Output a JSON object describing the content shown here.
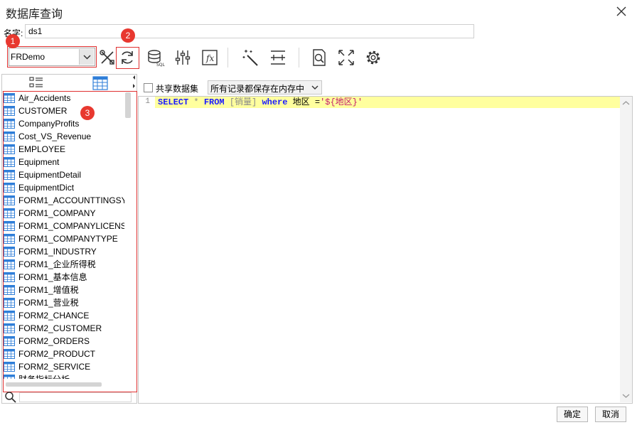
{
  "window": {
    "title": "数据库查询"
  },
  "name_field": {
    "label": "名字:",
    "value": "ds1"
  },
  "datasource": {
    "selected": "FRDemo"
  },
  "badges": [
    "1",
    "2",
    "3"
  ],
  "toolbar": {
    "icons": [
      "edit-connection-icon",
      "refresh-icon",
      "sql-database-icon",
      "parameters-icon",
      "formula-icon",
      "magic-wand-icon",
      "column-width-icon",
      "preview-icon",
      "expand-icon",
      "settings-icon"
    ]
  },
  "tables": [
    "Air_Accidents",
    "CUSTOMER",
    "CompanyProfits",
    "Cost_VS_Revenue",
    "EMPLOYEE",
    "Equipment",
    "EquipmentDetail",
    "EquipmentDict",
    "FORM1_ACCOUNTTINGSY",
    "FORM1_COMPANY",
    "FORM1_COMPANYLICENS",
    "FORM1_COMPANYTYPE",
    "FORM1_INDUSTRY",
    "FORM1_企业所得税",
    "FORM1_基本信息",
    "FORM1_增值税",
    "FORM1_营业税",
    "FORM2_CHANCE",
    "FORM2_CUSTOMER",
    "FORM2_ORDERS",
    "FORM2_PRODUCT",
    "FORM2_SERVICE",
    "财务指标分析"
  ],
  "sql_options": {
    "share_label": "共享数据集",
    "cache_option": "所有记录都保存在内存中"
  },
  "editor": {
    "line_number": "1",
    "kw_select": "SELECT",
    "star": " * ",
    "kw_from": "FROM",
    "table": " [销量] ",
    "kw_where": "where",
    "cond": " 地区 =",
    "param": "'${地区}'"
  },
  "footer": {
    "ok_label": "确定",
    "cancel_label": "取消"
  },
  "colors": {
    "badge": "#e8382f",
    "highlight": "#ffff9e",
    "keyword": "#1a1aff",
    "param": "#c2186b"
  }
}
